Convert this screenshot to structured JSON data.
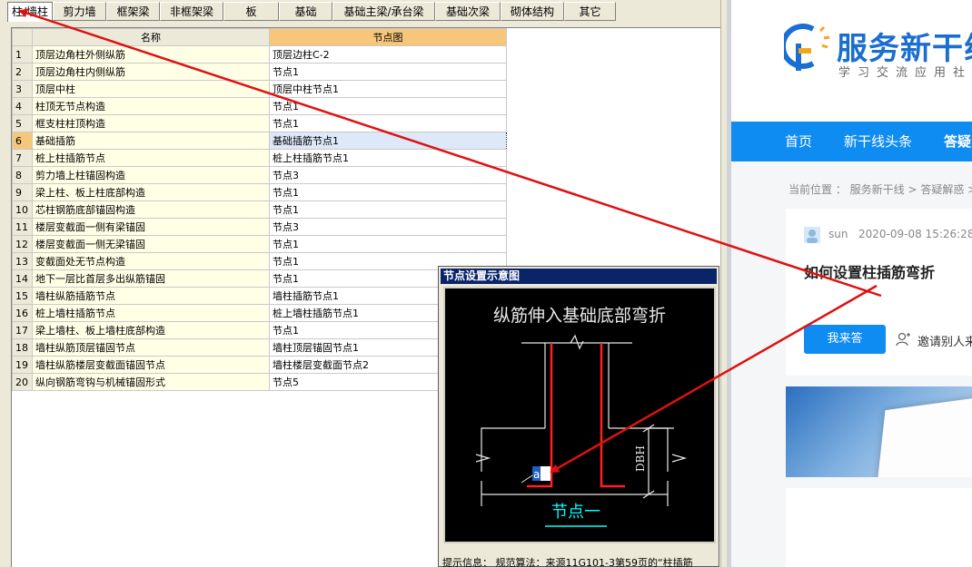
{
  "tabs": [
    "柱/墙柱",
    "剪力墙",
    "框架梁",
    "非框架梁",
    "板",
    "基础",
    "基础主梁/承台梁",
    "基础次梁",
    "砌体结构",
    "其它"
  ],
  "active_tab": 0,
  "grid": {
    "headers": {
      "name": "名称",
      "node": "节点图"
    },
    "selected_row": 6,
    "rows": [
      {
        "idx": "1",
        "name": "顶层边角柱外侧纵筋",
        "node": "顶层边柱C-2"
      },
      {
        "idx": "2",
        "name": "顶层边角柱内侧纵筋",
        "node": "节点1"
      },
      {
        "idx": "3",
        "name": "顶层中柱",
        "node": "顶层中柱节点1"
      },
      {
        "idx": "4",
        "name": "柱顶无节点构造",
        "node": "节点1"
      },
      {
        "idx": "5",
        "name": "框支柱柱顶构造",
        "node": "节点1"
      },
      {
        "idx": "6",
        "name": "基础插筋",
        "node": "基础插筋节点1"
      },
      {
        "idx": "7",
        "name": "桩上柱插筋节点",
        "node": "桩上柱插筋节点1"
      },
      {
        "idx": "8",
        "name": "剪力墙上柱锚固构造",
        "node": "节点3"
      },
      {
        "idx": "9",
        "name": "梁上柱、板上柱底部构造",
        "node": "节点1"
      },
      {
        "idx": "10",
        "name": "芯柱钢筋底部锚固构造",
        "node": "节点1"
      },
      {
        "idx": "11",
        "name": "楼层变截面一侧有梁锚固",
        "node": "节点3"
      },
      {
        "idx": "12",
        "name": "楼层变截面一侧无梁锚固",
        "node": "节点1"
      },
      {
        "idx": "13",
        "name": "变截面处无节点构造",
        "node": "节点1"
      },
      {
        "idx": "14",
        "name": "地下一层比首层多出纵筋锚固",
        "node": "节点1"
      },
      {
        "idx": "15",
        "name": "墙柱纵筋插筋节点",
        "node": "墙柱插筋节点1"
      },
      {
        "idx": "16",
        "name": "桩上墙柱插筋节点",
        "node": "桩上墙柱插筋节点1"
      },
      {
        "idx": "17",
        "name": "梁上墙柱、板上墙柱底部构造",
        "node": "节点1"
      },
      {
        "idx": "18",
        "name": "墙柱纵筋顶层锚固节点",
        "node": "墙柱顶层锚固节点1"
      },
      {
        "idx": "19",
        "name": "墙柱纵筋楼层变截面锚固节点",
        "node": "墙柱楼层变截面节点2"
      },
      {
        "idx": "20",
        "name": "纵向钢筋弯钩与机械锚固形式",
        "node": "节点5"
      }
    ]
  },
  "popup": {
    "title": "节点设置示意图",
    "diagram_title": "纵筋伸入基础底部弯折",
    "dim_label": "DBH",
    "bend_label": "a",
    "node_caption": "节点一",
    "info": "提示信息：  规范算法：来源11G101-3第59页的“柱插筋"
  },
  "web": {
    "logo_title": "服务新干线",
    "logo_subtitle": "学习交流应用社",
    "nav": [
      "首页",
      "新干线头条",
      "答疑"
    ],
    "breadcrumb": "当前位置 ：  服务新干线 > 答疑解惑 >",
    "question": {
      "user": "sun",
      "date": "2020-09-08 15:26:28",
      "title": "如何设置柱插筋弯折",
      "answer_button": "我来答",
      "invite": "邀请别人来"
    }
  },
  "colors": {
    "accent_blue": "#0f8cf1",
    "selected_header": "#f6c77a",
    "annotation_red": "#e01010",
    "rebar_red": "#ff2020",
    "dim_cyan": "#00ffff"
  }
}
